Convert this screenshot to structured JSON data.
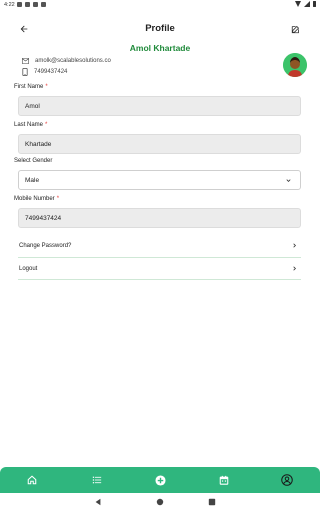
{
  "status_bar": {
    "time": "4:22"
  },
  "app_bar": {
    "title": "Profile"
  },
  "profile": {
    "name": "Amol Khartade",
    "email": "amolk@scalablesolutions.co",
    "phone": "7499437424"
  },
  "form": {
    "first_name_label": "First Name",
    "first_name_value": "Amol",
    "last_name_label": "Last Name",
    "last_name_value": "Khartade",
    "gender_label": "Select Gender",
    "gender_value": "Male",
    "mobile_label": "Mobile Number",
    "mobile_value": "7499437424",
    "required_mark": "*"
  },
  "menu": {
    "change_password": "Change Password?",
    "logout": "Logout"
  },
  "colors": {
    "accent": "#2fb67e",
    "name_green": "#1f8a3a",
    "required": "#e53935"
  },
  "icons": {
    "back": "arrow-left",
    "edit": "edit-square",
    "email": "mail",
    "phone": "smartphone",
    "nav": [
      "home",
      "list",
      "add-circle",
      "calendar",
      "account-circle"
    ]
  }
}
